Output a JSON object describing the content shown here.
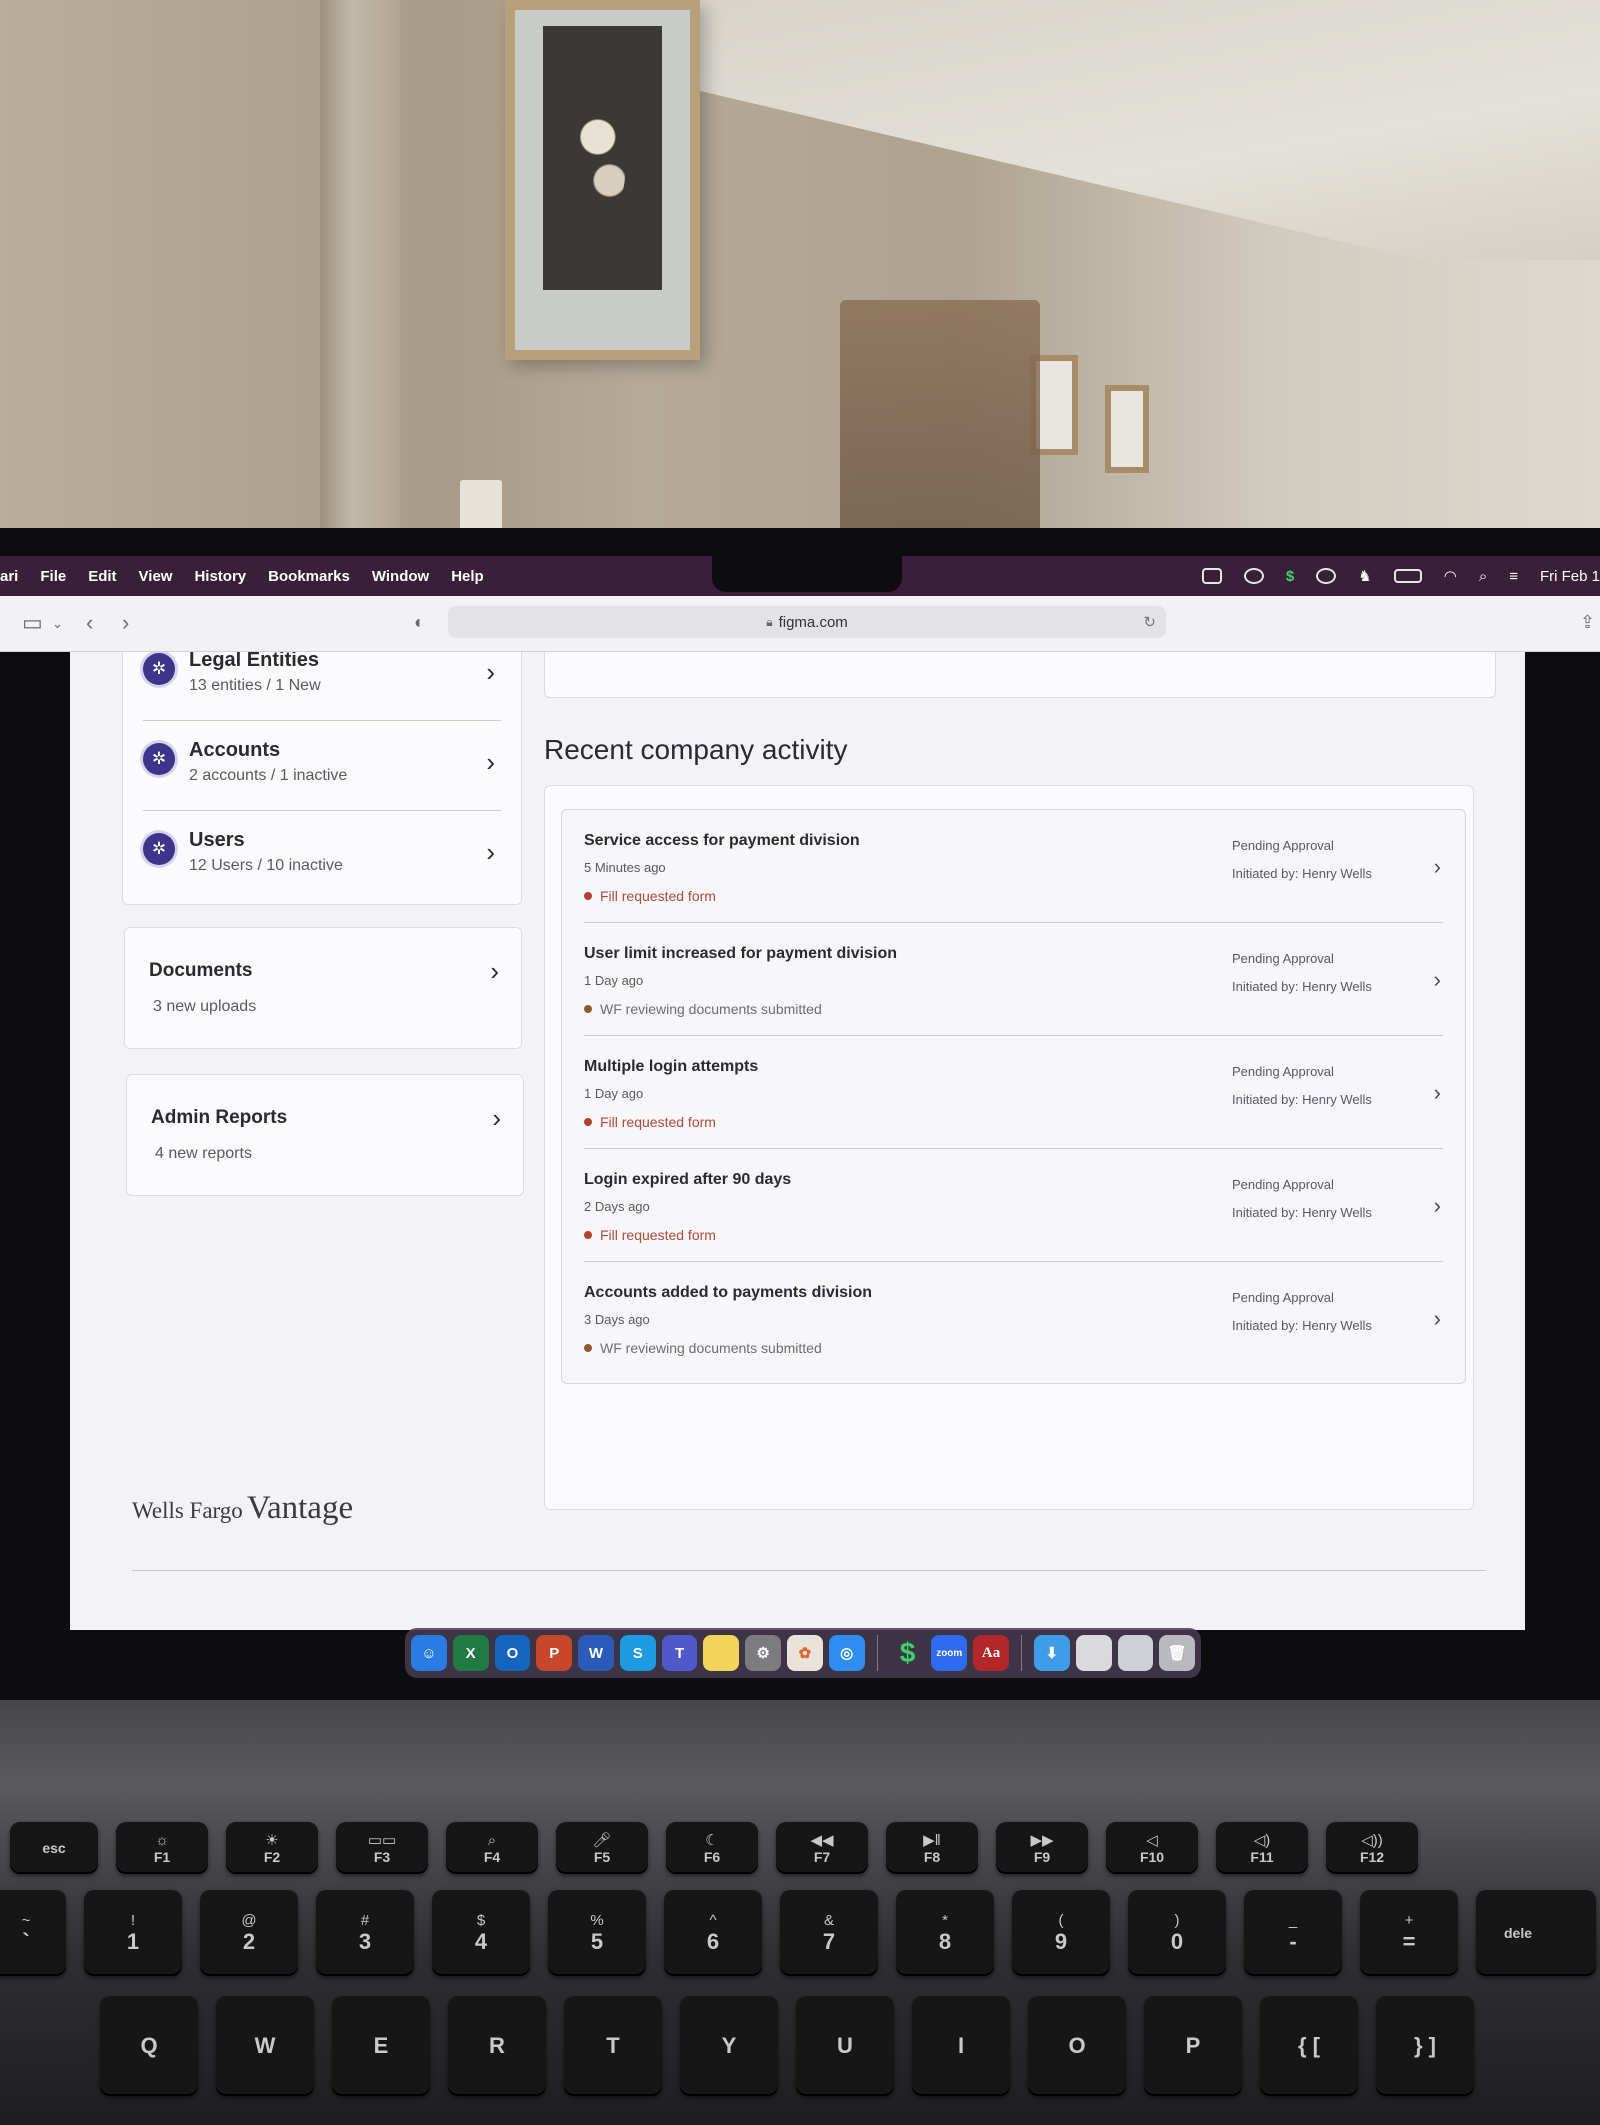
{
  "menubar": {
    "app_fragment": "ari",
    "items": [
      "File",
      "Edit",
      "View",
      "History",
      "Bookmarks",
      "Window",
      "Help"
    ],
    "clock": "Fri Feb 1"
  },
  "browser": {
    "url": "figma.com"
  },
  "sidebar": {
    "nav_items": [
      {
        "title": "Legal Entities",
        "subtitle": "13 entities / 1 New"
      },
      {
        "title": "Accounts",
        "subtitle": "2 accounts / 1 inactive"
      },
      {
        "title": "Users",
        "subtitle": "12 Users / 10 inactive"
      }
    ],
    "documents": {
      "title": "Documents",
      "subtitle": "3 new uploads"
    },
    "admin_reports": {
      "title": "Admin Reports",
      "subtitle": "4 new reports"
    }
  },
  "activity": {
    "heading": "Recent company activity",
    "items": [
      {
        "title": "Service access for payment division",
        "time": "5 Minutes ago",
        "status": "Fill requested form",
        "approval": "Pending Approval",
        "initiated": "Initiated by: Henry Wells"
      },
      {
        "title": "User limit increased for payment division",
        "time": "1 Day ago",
        "status": "WF reviewing documents submitted",
        "approval": "Pending Approval",
        "initiated": "Initiated by: Henry Wells"
      },
      {
        "title": "Multiple login attempts",
        "time": "1 Day ago",
        "status": "Fill requested form",
        "approval": "Pending Approval",
        "initiated": "Initiated by: Henry Wells"
      },
      {
        "title": "Login expired after 90 days",
        "time": "2 Days ago",
        "status": "Fill requested form",
        "approval": "Pending Approval",
        "initiated": "Initiated by: Henry Wells"
      },
      {
        "title": "Accounts added to payments division",
        "time": "3 Days ago",
        "status": "WF reviewing documents submitted",
        "approval": "Pending Approval",
        "initiated": "Initiated by: Henry Wells"
      }
    ]
  },
  "brand": {
    "wells": "Wells Fargo",
    "vantage": "Vantage"
  },
  "dock": {
    "apps": [
      "finder-icon",
      "excel-icon",
      "outlook-icon",
      "powerpoint-icon",
      "word-icon",
      "skype-icon",
      "teams-icon",
      "notes-icon",
      "system-settings-icon",
      "photos-icon",
      "safari-icon",
      "money-icon",
      "zoom-icon",
      "dictionary-icon",
      "downloads-folder-icon",
      "documents-icon",
      "screenshots-icon",
      "trash-icon"
    ],
    "zoom_label": "zoom",
    "dictionary_label": "Aa"
  },
  "keyboard": {
    "fn_row": [
      "esc",
      "F1",
      "F2",
      "F3",
      "F4",
      "F5",
      "F6",
      "F7",
      "F8",
      "F9",
      "F10",
      "F11",
      "F12"
    ],
    "num_row": [
      [
        "~",
        "`"
      ],
      [
        "!",
        "1"
      ],
      [
        "@",
        "2"
      ],
      [
        "#",
        "3"
      ],
      [
        "$",
        "4"
      ],
      [
        "%",
        "5"
      ],
      [
        "^",
        "6"
      ],
      [
        "&",
        "7"
      ],
      [
        "*",
        "8"
      ],
      [
        "(",
        "9"
      ],
      [
        ")",
        "0"
      ],
      [
        "_",
        "-"
      ],
      [
        "+",
        "="
      ],
      [
        "",
        "dele"
      ]
    ],
    "q_row": [
      "Q",
      "W",
      "E",
      "R",
      "T",
      "Y",
      "U",
      "I",
      "O",
      "P",
      "{ [",
      "} ]"
    ]
  },
  "colors": {
    "menubar": "#3b1f3a",
    "badge": "#3e3489",
    "status_red": "#b04a3c"
  }
}
